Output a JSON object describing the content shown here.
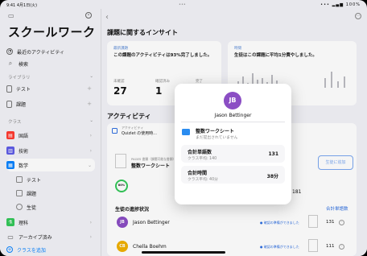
{
  "status": {
    "time": "9:41",
    "date": "4月1日(火)",
    "right": "•••  ▂▄▆ 100%"
  },
  "sidebar": {
    "title": "スクールワーク",
    "items": [
      {
        "label": "最近のアクティビティ",
        "icon": "clock-icon"
      },
      {
        "label": "検索",
        "icon": "search-icon"
      }
    ],
    "library_header": "ライブラリ",
    "library_items": [
      {
        "label": "テスト",
        "icon": "document-icon"
      },
      {
        "label": "課題",
        "icon": "document-icon"
      }
    ],
    "class_header": "クラス",
    "classes": [
      {
        "label": "国語",
        "icon": "book-icon",
        "color": "#ff3b30"
      },
      {
        "label": "技術",
        "icon": "chart-icon",
        "color": "#5e5ce6"
      },
      {
        "label": "数学",
        "icon": "doc-icon",
        "color": "#0a84ff"
      }
    ],
    "subitems": [
      {
        "label": "テスト"
      },
      {
        "label": "課題"
      },
      {
        "label": "生徒"
      }
    ],
    "more_classes": [
      {
        "label": "理科",
        "icon": "flask-icon",
        "color": "#34c759"
      },
      {
        "label": "アーカイブ済み",
        "icon": "archive-icon",
        "color": "#555"
      }
    ],
    "add_class": "クラスを追加"
  },
  "main": {
    "insights_title": "課題に関するインサイト",
    "card1": {
      "label": "最新課題",
      "text": "この課題のアクティビティは93%完了しました。",
      "stats": [
        {
          "label": "未確認",
          "value": "27"
        },
        {
          "label": "確認済み",
          "value": "1"
        },
        {
          "label": "完了",
          "value": "0"
        }
      ]
    },
    "card2": {
      "label": "時間",
      "text": "生徒はこの課題に平均1分費やしました。"
    },
    "activity_title": "アクティビティ",
    "activity_row": {
      "sub": "アクティビティ",
      "title": "Quizlet の使用時..."
    },
    "lesson": {
      "caption": "PAGES 書類（課題可能な書類）",
      "title": "整数ワークシート"
    },
    "add_button": "生徒に追加",
    "progress_pct": "80%",
    "count_181": "181",
    "students_title": "生徒の進捗状況",
    "students_link": "合計単語数",
    "students": [
      {
        "initials": "JB",
        "name": "Jason Bettinger",
        "badge": "確認の準備ができました",
        "count": "131",
        "color": "#8b4ec4"
      },
      {
        "initials": "CB",
        "name": "Chella Boehm",
        "badge": "確認の準備ができました",
        "count": "111",
        "color": "#f0b000"
      }
    ]
  },
  "popover": {
    "initials": "JB",
    "name": "Jason Bettinger",
    "doc_title": "整数ワークシート",
    "doc_sub": "まだ提出されていません",
    "rows": [
      {
        "title": "合計単語数",
        "sub": "クラス平均: 140",
        "value": "131"
      },
      {
        "title": "合計時間",
        "sub": "クラス平均: 40分",
        "value": "38分"
      }
    ]
  }
}
